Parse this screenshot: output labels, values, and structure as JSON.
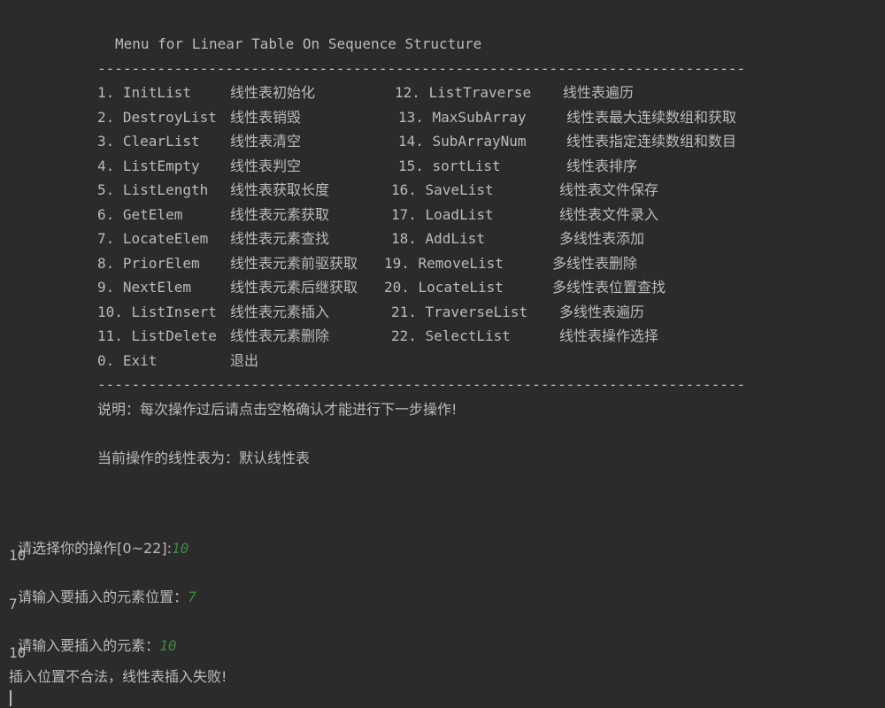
{
  "menu": {
    "title": "Menu for Linear Table On Sequence Structure",
    "divider": "----------------------------------------------------------------------------",
    "left_items": [
      {
        "label": "1. InitList",
        "desc": "线性表初始化"
      },
      {
        "label": "2. DestroyList",
        "desc": "线性表销毁"
      },
      {
        "label": "3. ClearList",
        "desc": "线性表清空"
      },
      {
        "label": "4. ListEmpty",
        "desc": "线性表判空"
      },
      {
        "label": "5. ListLength",
        "desc": "线性表获取长度"
      },
      {
        "label": "6. GetElem",
        "desc": "线性表元素获取"
      },
      {
        "label": "7. LocateElem",
        "desc": "线性表元素查找"
      },
      {
        "label": "8. PriorElem",
        "desc": "线性表元素前驱获取"
      },
      {
        "label": "9. NextElem",
        "desc": "线性表元素后继获取"
      },
      {
        "label": "10. ListInsert",
        "desc": "线性表元素插入"
      },
      {
        "label": "11. ListDelete",
        "desc": "线性表元素删除"
      },
      {
        "label": "0. Exit",
        "desc": "退出"
      }
    ],
    "right_items": [
      {
        "label": "12. ListTraverse",
        "desc": "线性表遍历"
      },
      {
        "label": "13. MaxSubArray",
        "desc": "线性表最大连续数组和获取"
      },
      {
        "label": "14. SubArrayNum",
        "desc": "线性表指定连续数组和数目"
      },
      {
        "label": "15. sortList",
        "desc": "线性表排序"
      },
      {
        "label": "16. SaveList",
        "desc": "线性表文件保存"
      },
      {
        "label": "17. LoadList",
        "desc": "线性表文件录入"
      },
      {
        "label": "18. AddList",
        "desc": "多线性表添加"
      },
      {
        "label": "19. RemoveList",
        "desc": "多线性表删除"
      },
      {
        "label": "20. LocateList",
        "desc": "多线性表位置查找"
      },
      {
        "label": "21. TraverseList",
        "desc": "多线性表遍历"
      },
      {
        "label": "22. SelectList",
        "desc": "线性表操作选择"
      }
    ],
    "note": "说明：每次操作过后请点击空格确认才能进行下一步操作!",
    "current_table": "当前操作的线性表为：默认线性表"
  },
  "console": {
    "prompt_select": "请选择你的操作[0~22]:",
    "input_select": "10",
    "echo_select": "10",
    "prompt_position": "请输入要插入的元素位置：",
    "input_position": "7",
    "echo_position": "7",
    "prompt_element": "请输入要插入的元素：",
    "input_element": "10",
    "echo_element": "10",
    "result": "插入位置不合法，线性表插入失败!"
  },
  "colors": {
    "background": "#2b2b2b",
    "text": "#bbbbbb",
    "user_input": "#3c8a3c"
  }
}
